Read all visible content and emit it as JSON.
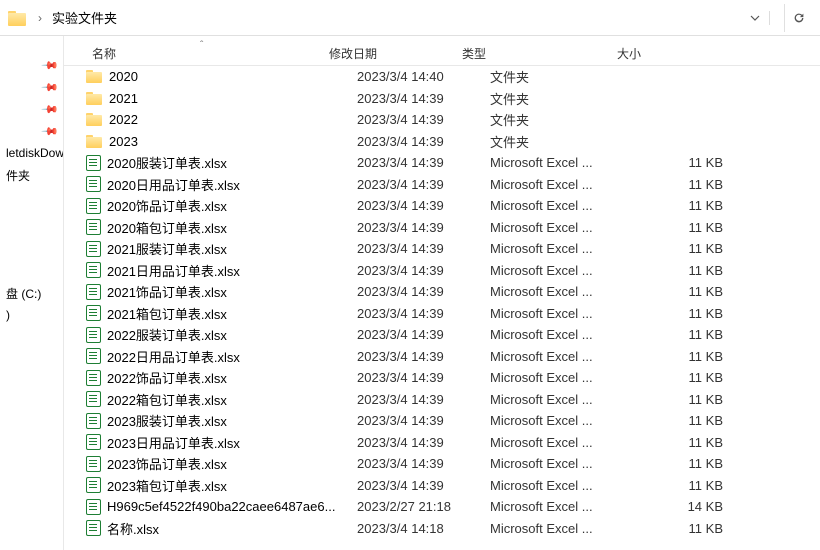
{
  "breadcrumb": {
    "current": "实验文件夹"
  },
  "columns": {
    "name": "名称",
    "date": "修改日期",
    "type": "类型",
    "size": "大小"
  },
  "sidebar": {
    "items": [
      {
        "label": ""
      },
      {
        "label": ""
      },
      {
        "label": ""
      },
      {
        "label": ""
      },
      {
        "label": "letdiskDow"
      },
      {
        "label": "件夹"
      },
      {
        "label": "盘 (C:)"
      },
      {
        "label": ")"
      }
    ]
  },
  "type_labels": {
    "folder": "文件夹",
    "excel": "Microsoft Excel ..."
  },
  "files": [
    {
      "icon": "folder",
      "name": "2020",
      "date": "2023/3/4 14:40",
      "type": "文件夹",
      "size": ""
    },
    {
      "icon": "folder",
      "name": "2021",
      "date": "2023/3/4 14:39",
      "type": "文件夹",
      "size": ""
    },
    {
      "icon": "folder",
      "name": "2022",
      "date": "2023/3/4 14:39",
      "type": "文件夹",
      "size": ""
    },
    {
      "icon": "folder",
      "name": "2023",
      "date": "2023/3/4 14:39",
      "type": "文件夹",
      "size": ""
    },
    {
      "icon": "excel",
      "name": "2020服装订单表.xlsx",
      "date": "2023/3/4 14:39",
      "type": "Microsoft Excel ...",
      "size": "11 KB"
    },
    {
      "icon": "excel",
      "name": "2020日用品订单表.xlsx",
      "date": "2023/3/4 14:39",
      "type": "Microsoft Excel ...",
      "size": "11 KB"
    },
    {
      "icon": "excel",
      "name": "2020饰品订单表.xlsx",
      "date": "2023/3/4 14:39",
      "type": "Microsoft Excel ...",
      "size": "11 KB"
    },
    {
      "icon": "excel",
      "name": "2020箱包订单表.xlsx",
      "date": "2023/3/4 14:39",
      "type": "Microsoft Excel ...",
      "size": "11 KB"
    },
    {
      "icon": "excel",
      "name": "2021服装订单表.xlsx",
      "date": "2023/3/4 14:39",
      "type": "Microsoft Excel ...",
      "size": "11 KB"
    },
    {
      "icon": "excel",
      "name": "2021日用品订单表.xlsx",
      "date": "2023/3/4 14:39",
      "type": "Microsoft Excel ...",
      "size": "11 KB"
    },
    {
      "icon": "excel",
      "name": "2021饰品订单表.xlsx",
      "date": "2023/3/4 14:39",
      "type": "Microsoft Excel ...",
      "size": "11 KB"
    },
    {
      "icon": "excel",
      "name": "2021箱包订单表.xlsx",
      "date": "2023/3/4 14:39",
      "type": "Microsoft Excel ...",
      "size": "11 KB"
    },
    {
      "icon": "excel",
      "name": "2022服装订单表.xlsx",
      "date": "2023/3/4 14:39",
      "type": "Microsoft Excel ...",
      "size": "11 KB"
    },
    {
      "icon": "excel",
      "name": "2022日用品订单表.xlsx",
      "date": "2023/3/4 14:39",
      "type": "Microsoft Excel ...",
      "size": "11 KB"
    },
    {
      "icon": "excel",
      "name": "2022饰品订单表.xlsx",
      "date": "2023/3/4 14:39",
      "type": "Microsoft Excel ...",
      "size": "11 KB"
    },
    {
      "icon": "excel",
      "name": "2022箱包订单表.xlsx",
      "date": "2023/3/4 14:39",
      "type": "Microsoft Excel ...",
      "size": "11 KB"
    },
    {
      "icon": "excel",
      "name": "2023服装订单表.xlsx",
      "date": "2023/3/4 14:39",
      "type": "Microsoft Excel ...",
      "size": "11 KB"
    },
    {
      "icon": "excel",
      "name": "2023日用品订单表.xlsx",
      "date": "2023/3/4 14:39",
      "type": "Microsoft Excel ...",
      "size": "11 KB"
    },
    {
      "icon": "excel",
      "name": "2023饰品订单表.xlsx",
      "date": "2023/3/4 14:39",
      "type": "Microsoft Excel ...",
      "size": "11 KB"
    },
    {
      "icon": "excel",
      "name": "2023箱包订单表.xlsx",
      "date": "2023/3/4 14:39",
      "type": "Microsoft Excel ...",
      "size": "11 KB"
    },
    {
      "icon": "excel",
      "name": "H969c5ef4522f490ba22caee6487ae6...",
      "date": "2023/2/27 21:18",
      "type": "Microsoft Excel ...",
      "size": "14 KB"
    },
    {
      "icon": "excel",
      "name": "名称.xlsx",
      "date": "2023/3/4 14:18",
      "type": "Microsoft Excel ...",
      "size": "11 KB"
    }
  ]
}
